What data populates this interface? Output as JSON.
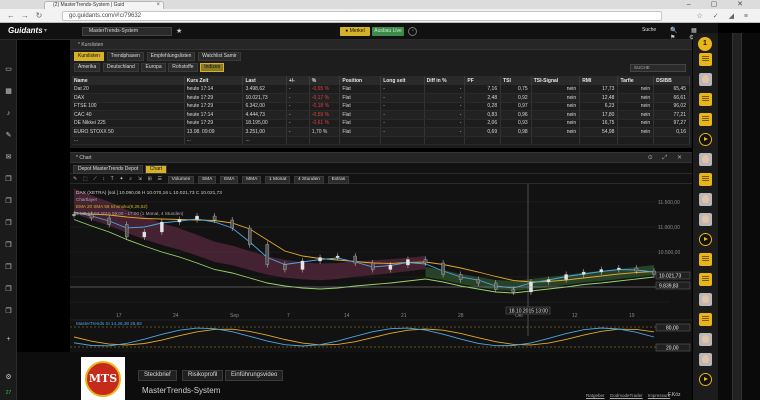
{
  "browser": {
    "tab_title": "(2) MasterTrends-System | Guid",
    "url": "go.guidants.com/#!c/79632",
    "nav_back": "←",
    "nav_forward": "→",
    "nav_reload": "C",
    "window_controls": "– ▢ ✕"
  },
  "topbar": {
    "logo": "Guidants",
    "system_select": "MasterTrends-System",
    "merkel_label": "● Merkel",
    "green_label": "Ausbau Live",
    "speed_icon": "speedometer-icon",
    "search_label": "Suche"
  },
  "table_panel": {
    "title": "* Kurslisten",
    "tabs1": [
      "Kurslisten",
      "Trendphasen",
      "Empfehlungslisten",
      "Watchlist Samir"
    ],
    "tabs2": [
      "Amerika",
      "Deutschland",
      "Europa",
      "Rohstoffe",
      "Indizes"
    ],
    "tabs1_active": "Kurslisten",
    "tabs2_active": "Indizes",
    "filter_placeholder": "SUCHE",
    "columns": [
      "Name",
      "Kurs Zeit",
      "Last",
      "+/-",
      "%",
      "Position",
      "Long seit",
      "Diff in %",
      "PF",
      "TSI",
      "TSI-Signal",
      "RMI",
      "Tarfie",
      "DSIBB"
    ],
    "rows": [
      [
        "Dat 20",
        "heute 17:14",
        "3.498,62",
        "-",
        "-0,65 %",
        "Flat",
        "-",
        "-",
        "7,16",
        "0,75",
        "nein",
        "17,73",
        "nein",
        "65,45"
      ],
      [
        "DAX",
        "heute 17:29",
        "10.021,73",
        "-",
        "-0,17 %",
        "Flat",
        "-",
        "-",
        "2,48",
        "0,92",
        "nein",
        "12,48",
        "nein",
        "66,61"
      ],
      [
        "FTSE 100",
        "heute 17:29",
        "6.342,00",
        "-",
        "-0,18 %",
        "Flat",
        "-",
        "-",
        "0,28",
        "0,97",
        "nein",
        "6,23",
        "nein",
        "96,02"
      ],
      [
        "CAC 40",
        "heute 17:14",
        "4.444,73",
        "-",
        "-0,59 %",
        "Flat",
        "-",
        "-",
        "0,83",
        "0,96",
        "nein",
        "17,80",
        "nein",
        "77,21"
      ],
      [
        "DE Nikkei 225",
        "heute 17:29",
        "18.195,00",
        "-",
        "-0,61 %",
        "Flat",
        "-",
        "-",
        "2,06",
        "0,93",
        "nein",
        "16,75",
        "nein",
        "97,27"
      ],
      [
        "EURO STOXX 50",
        "13.08. 09:09",
        "3.251,00",
        "-",
        "1,70 %",
        "Flat",
        "-",
        "-",
        "0,69",
        "0,98",
        "nein",
        "54,98",
        "nein",
        "0,16"
      ],
      [
        "...",
        "...",
        "...",
        "",
        "",
        "",
        "",
        "",
        "",
        "",
        "",
        "",
        "",
        ""
      ]
    ]
  },
  "chart_panel": {
    "title": "* Chart",
    "tabs": [
      "Depot MasterTrends Depot",
      "Chart"
    ],
    "tabs_active": "Chart",
    "toolbar": {
      "tools": [
        "✎",
        "⬚",
        "⟋",
        "↕",
        "T",
        "✦",
        "⌕",
        "⇲",
        "⊞",
        "☰"
      ],
      "indicator_buttons": [
        "Volumen",
        "SMA",
        "EMA",
        "MMA"
      ],
      "period_a": "1 Monat",
      "period_b": "4 Stunden",
      "extras": "Extras"
    },
    "legend_line": "DAX (XETRA) [sol.] 10.090,06 H 10.070,16 L 10.021,73 C 10.021,73",
    "legend_sub1": "Chartlayer",
    "legend_sub2": "EMA 20  SMA 56  Ichimoku(9,26,52)",
    "legend_sub3": "3 MT 17.03.2015 09:00 - 17:00 (1 Monat, 4 Stunden)",
    "osc_legend": "MasterTrends SI 14,26,38 25,93",
    "time_tooltip": "18.10.2015 13:00",
    "price_tag_current": "10.021,73",
    "price_tag_second": "9.839,83",
    "osc_tag_high": "80,00",
    "osc_tag_low": "20,00"
  },
  "chart_data": {
    "type": "line",
    "title": "",
    "xlabel": "",
    "ylabel": "",
    "x_tick_labels": [
      "17",
      "24",
      "Sep",
      "7",
      "14",
      "21",
      "28",
      "Okt",
      "12",
      "19"
    ],
    "y_tick_labels": [
      "11.500,00",
      "11.000,00",
      "10.500,00",
      "10.000,00"
    ],
    "ylim": [
      9300,
      11700
    ],
    "grid": true,
    "series": [
      {
        "name": "Kerzen",
        "color": "#dddddd",
        "values": [
          11250,
          11180,
          11050,
          10800,
          10900,
          11100,
          11150,
          11220,
          11140,
          10980,
          10650,
          10250,
          10150,
          10320,
          10390,
          10420,
          10280,
          10150,
          10240,
          10350,
          10280,
          10050,
          9950,
          9880,
          9750,
          9700,
          9900,
          9950,
          10050,
          10100,
          10150,
          10180,
          10120,
          10050
        ]
      },
      {
        "color": "#e3a92a",
        "values": [
          11280,
          11260,
          11240,
          11200,
          11170,
          11160,
          11150,
          11140,
          11130,
          11080,
          10960,
          10740,
          10520,
          10420,
          10370,
          10340,
          10310,
          10280,
          10270,
          10290,
          10300,
          10250,
          10180,
          10100,
          10010,
          9930,
          9900,
          9910,
          9940,
          9980,
          10020,
          10060,
          10090,
          10110
        ]
      },
      {
        "color": "#4da6e6",
        "values": [
          11300,
          11220,
          11120,
          10980,
          11000,
          11080,
          11120,
          11160,
          11100,
          10980,
          10700,
          10390,
          10250,
          10300,
          10350,
          10380,
          10300,
          10200,
          10230,
          10290,
          10260,
          10120,
          10000,
          9940,
          9820,
          9780,
          9880,
          9940,
          10010,
          10060,
          10110,
          10150,
          10140,
          10100
        ]
      },
      {
        "color": "#9ad16a",
        "values": [
          11150,
          11020,
          10900,
          10750,
          10620,
          10500,
          10400,
          10280,
          10150,
          10080,
          9980,
          9880,
          9820,
          9780,
          9760,
          9780,
          9820,
          9850,
          9880,
          9920,
          9960,
          9900,
          9820,
          9760,
          9700,
          9680,
          9720,
          9760,
          9800,
          9850,
          9880,
          9920,
          9960,
          10000
        ]
      }
    ]
  },
  "sidebar_right": {
    "top_badge": "1"
  },
  "video_player": {
    "logo_text": "MTS",
    "tabs": [
      "Steckbrief",
      "Risikoprofil",
      "Einführungsvideo"
    ],
    "title": "MasterTrends-System",
    "links": [
      "Ratgeber",
      "GodmodeTrader",
      "Impressum"
    ],
    "user": "F.Köz",
    "badge": "27"
  }
}
